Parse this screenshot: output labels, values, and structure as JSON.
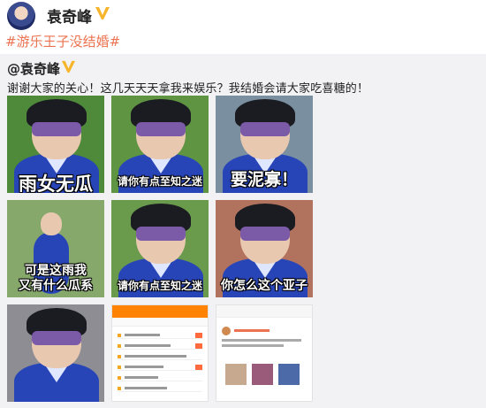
{
  "post": {
    "author": "袁奇峰",
    "topic": "#游乐王子没结婚#"
  },
  "repost": {
    "author": "@袁奇峰",
    "text": "谢谢大家的关心！这几天天天拿我来娱乐？我结婚会请大家吃喜糖的！"
  },
  "images": [
    {
      "caption": "雨女无瓜",
      "bg": "#4e8a3a"
    },
    {
      "caption": "请你有点至知之迷",
      "bg": "#5f9442"
    },
    {
      "caption": "要泥寡！",
      "bg": "#7a8fa0"
    },
    {
      "caption": "可是这雨我\n又有什么瓜系",
      "bg": "#87a86b"
    },
    {
      "caption": "请你有点至知之迷",
      "bg": "#6a9a4c"
    },
    {
      "caption": "你怎么这个亚子",
      "bg": "#b2735e"
    },
    {
      "caption": "",
      "bg": "#8d8d93"
    }
  ],
  "colors": {
    "accent": "#eb7350",
    "verified": "#f7b52c"
  }
}
